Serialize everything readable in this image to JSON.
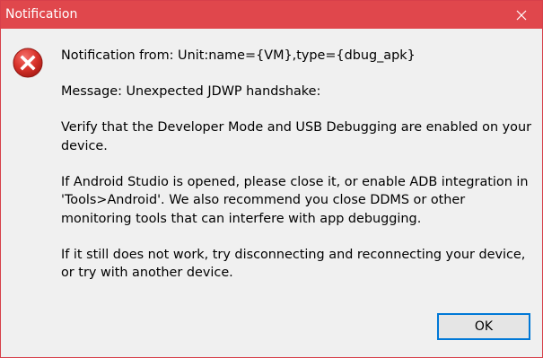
{
  "window": {
    "title": "Notification",
    "close_icon": "close-icon",
    "accent_color": "#e0474c"
  },
  "dialog": {
    "icon": "error-icon",
    "paragraphs": [
      "Notification from: Unit:name={VM},type={dbug_apk}",
      "Message: Unexpected JDWP handshake:",
      "Verify that the Developer Mode and USB Debugging are enabled on your device.",
      "If Android Studio is opened, please close it, or enable ADB integration in 'Tools>Android'. We also recommend you close DDMS or other monitoring tools that can interfere with app debugging.",
      "If it still does not work, try disconnecting and reconnecting your device, or try with another device."
    ],
    "ok_label": "OK"
  }
}
